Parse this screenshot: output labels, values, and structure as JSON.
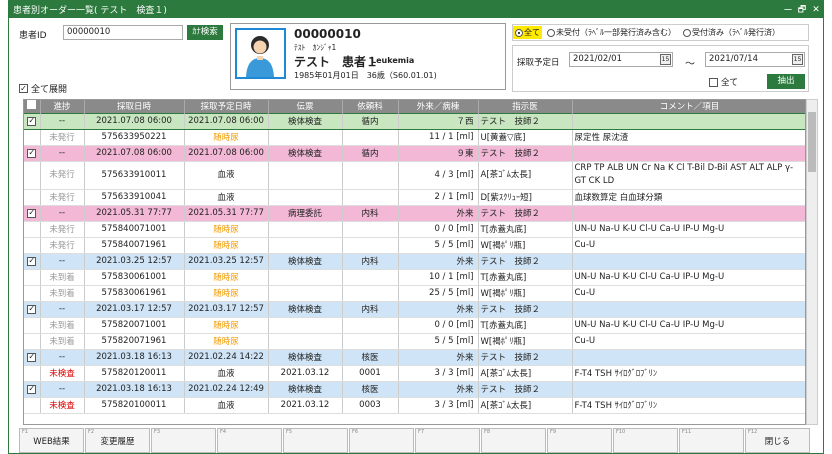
{
  "window": {
    "title": "患者別オーダー一覧( テスト　検査１)",
    "controls": [
      "ー",
      "🗗",
      "✕"
    ]
  },
  "search": {
    "label": "患者ID",
    "value": "00000010",
    "button": "ｶﾅ検索"
  },
  "expand_all": {
    "label": "全て展開",
    "checked": true
  },
  "patient": {
    "number": "00000010",
    "kana": "ﾃｽﾄ　ｶﾝｼﾞｬ1",
    "name": "テスト　患者１",
    "diagnosis": "Leukemia",
    "birth": "1985年01月01日　36歳（S60.01.01)"
  },
  "filter": {
    "options": [
      {
        "label": "全て",
        "selected": true
      },
      {
        "label": "未受付（ﾗﾍﾞﾙ一部発行済み含む）",
        "selected": false
      },
      {
        "label": "受付済み（ﾗﾍﾞﾙ発行済）",
        "selected": false
      }
    ]
  },
  "date_range": {
    "label": "採取予定日",
    "from": "2021/02/01",
    "tilde": "～",
    "to": "2021/07/14",
    "cal_icon": "15",
    "all_label": "全て",
    "extract_button": "抽出"
  },
  "grid": {
    "headers": [
      "",
      "進捗",
      "採取日時",
      "採取予定日時",
      "伝票",
      "依頼科",
      "外来／病棟",
      "指示医",
      "コメント／項目"
    ],
    "rows": [
      {
        "type": "green",
        "sel": true,
        "check": "✓",
        "cells": [
          "--",
          "2021.07.08  06:00",
          "2021.07.08  06:00",
          "検体検査",
          "循内",
          "７西",
          "テスト　技師２",
          ""
        ]
      },
      {
        "type": "sub",
        "check": "",
        "cells": [
          "未発行",
          "575633950221",
          "随時尿",
          "",
          "",
          "11 / 1  [ml]",
          "U[黄蓋▽底]",
          "尿定性 尿沈渣"
        ]
      },
      {
        "type": "pink",
        "check": "✓",
        "cells": [
          "--",
          "2021.07.08  06:00",
          "2021.07.08  06:00",
          "検体検査",
          "循内",
          "９東",
          "テスト　技師２",
          ""
        ]
      },
      {
        "type": "sub",
        "tall": true,
        "check": "",
        "cells": [
          "未発行",
          "575633910011",
          "血液",
          "",
          "",
          "4 / 3  [ml]",
          "A[茶ｺﾞﾑ太長]",
          "CRP TP ALB UN Cr Na K Cl T-Bil D-Bil AST ALT ALP γ-GT CK LD"
        ]
      },
      {
        "type": "sub",
        "check": "",
        "cells": [
          "未発行",
          "575633910041",
          "血液",
          "",
          "",
          "2 / 1  [ml]",
          "D[紫ｽｸﾘｭｰ短]",
          "血球数算定 白血球分類"
        ]
      },
      {
        "type": "pink",
        "check": "✓",
        "cells": [
          "--",
          "2021.05.31  77:77",
          "2021.05.31  77:77",
          "病理委託",
          "内科",
          "外来",
          "テスト　技師２",
          ""
        ]
      },
      {
        "type": "sub",
        "check": "",
        "cells": [
          "未発行",
          "575840071001",
          "随時尿",
          "",
          "",
          "0 / 0  [ml]",
          "T[赤蓋丸底]",
          "UN-U Na-U K-U Cl-U Ca-U IP-U Mg-U"
        ]
      },
      {
        "type": "sub",
        "check": "",
        "cells": [
          "未発行",
          "575840071961",
          "随時尿",
          "",
          "",
          "5 / 5  [ml]",
          "W[褐ﾎﾟﾘ瓶]",
          "Cu-U"
        ]
      },
      {
        "type": "blue",
        "check": "✓",
        "cells": [
          "--",
          "2021.03.25  12:57",
          "2021.03.25  12:57",
          "検体検査",
          "内科",
          "外来",
          "テスト　技師２",
          ""
        ]
      },
      {
        "type": "sub",
        "check": "",
        "cells": [
          "未到着",
          "575830061001",
          "随時尿",
          "",
          "",
          "10 / 1  [ml]",
          "T[赤蓋丸底]",
          "UN-U Na-U K-U Cl-U Ca-U IP-U Mg-U"
        ]
      },
      {
        "type": "sub",
        "check": "",
        "cells": [
          "未到着",
          "575830061961",
          "随時尿",
          "",
          "",
          "25 / 5  [ml]",
          "W[褐ﾎﾟﾘ瓶]",
          "Cu-U"
        ]
      },
      {
        "type": "blue",
        "check": "✓",
        "cells": [
          "--",
          "2021.03.17  12:57",
          "2021.03.17  12:57",
          "検体検査",
          "内科",
          "外来",
          "テスト　技師２",
          ""
        ]
      },
      {
        "type": "sub",
        "check": "",
        "cells": [
          "未到着",
          "575820071001",
          "随時尿",
          "",
          "",
          "0 / 0  [ml]",
          "T[赤蓋丸底]",
          "UN-U Na-U K-U Cl-U Ca-U IP-U Mg-U"
        ]
      },
      {
        "type": "sub",
        "check": "",
        "cells": [
          "未到着",
          "575820071961",
          "随時尿",
          "",
          "",
          "5 / 5  [ml]",
          "W[褐ﾎﾟﾘ瓶]",
          "Cu-U"
        ]
      },
      {
        "type": "blue",
        "check": "✓",
        "cells": [
          "--",
          "2021.03.18  16:13",
          "2021.02.24  14:22",
          "検体検査",
          "核医",
          "外来",
          "テスト　技師２",
          ""
        ]
      },
      {
        "type": "sub",
        "check": "",
        "cells": [
          "未検査",
          "575820120011",
          "血液",
          "2021.03.12",
          "0001",
          "3 / 3  [ml]",
          "A[茶ｺﾞﾑ太長]",
          "F-T4 TSH ｻｲﾛｸﾞﾛﾌﾞﾘﾝ"
        ]
      },
      {
        "type": "blue",
        "check": "✓",
        "cells": [
          "--",
          "2021.03.18  16:13",
          "2021.02.24  12:49",
          "検体検査",
          "核医",
          "外来",
          "テスト　技師２",
          ""
        ]
      },
      {
        "type": "sub",
        "check": "",
        "cells": [
          "未検査",
          "575820100011",
          "血液",
          "2021.03.12",
          "0003",
          "3 / 3  [ml]",
          "A[茶ｺﾞﾑ太長]",
          "F-T4 TSH ｻｲﾛｸﾞﾛﾌﾞﾘﾝ"
        ]
      }
    ]
  },
  "fkeys": [
    {
      "fn": "F1",
      "label": "WEB結果"
    },
    {
      "fn": "F2",
      "label": "変更履歴"
    },
    {
      "fn": "F3",
      "label": ""
    },
    {
      "fn": "F4",
      "label": ""
    },
    {
      "fn": "F5",
      "label": ""
    },
    {
      "fn": "F6",
      "label": ""
    },
    {
      "fn": "F7",
      "label": ""
    },
    {
      "fn": "F8",
      "label": ""
    },
    {
      "fn": "F9",
      "label": ""
    },
    {
      "fn": "F10",
      "label": ""
    },
    {
      "fn": "F11",
      "label": ""
    },
    {
      "fn": "F12",
      "label": "閉じる"
    }
  ]
}
